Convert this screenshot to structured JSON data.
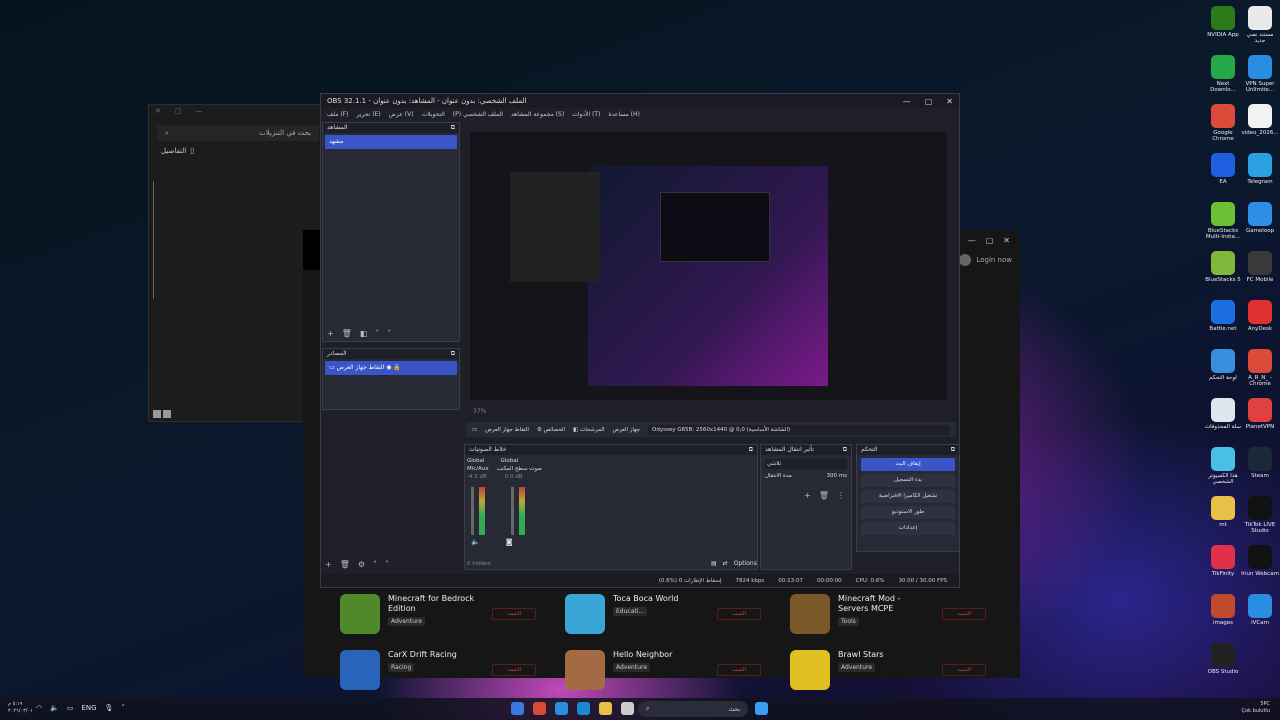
{
  "settings": {
    "search_placeholder": "بحث في التنزيلات",
    "details_label": "التفاصيل"
  },
  "store": {
    "login": "Login now",
    "buttons_label": "التثبيت",
    "apps": [
      {
        "name": "Minecraft for Bedrock Edition",
        "category": "Adventure",
        "color": "#4f8a2a"
      },
      {
        "name": "Toca Boca World",
        "category": "Educati...",
        "color": "#3aa6d8"
      },
      {
        "name": "Minecraft Mod - Servers MCPE",
        "category": "Tools",
        "color": "#7a5a2a"
      },
      {
        "name": "CarX Drift Racing",
        "category": "Racing",
        "color": "#2a64b8"
      },
      {
        "name": "Hello Neighbor",
        "category": "Adventure",
        "color": "#a46a44"
      },
      {
        "name": "Brawl Stars",
        "category": "Adventure",
        "color": "#e0c020"
      }
    ]
  },
  "obs": {
    "title": "OBS 32.1.1 - الملف الشخصي: بدون عنوان - المشاهد: بدون عنوان",
    "menu": [
      "ملف (F)",
      "تحرير (E)",
      "عرض (V)",
      "التحويلات",
      "(P) الملف الشخصي",
      "مجموعة المشاهد (S)",
      "الأدوات (T)",
      "مساعدة (H)"
    ],
    "scenes": {
      "header": "المشاهد",
      "items": [
        "مشهد"
      ]
    },
    "sources": {
      "header": "المصادر",
      "items": [
        "التقاط جهاز العرض"
      ]
    },
    "source_bar": {
      "properties": "الخصائص",
      "filters": "المرشحات",
      "display": "جهاز العرض",
      "value": "Odyssey G65B: 2560x1440 @ 0,0 (الشاشة الأساسية)",
      "display_capture": "التقاط جهاز العرض"
    },
    "audio": {
      "header": "خلاط الصوتيات",
      "ch1": "Mic/Aux",
      "ch2": "صوت سطح المكتب",
      "global": "Global",
      "db1": "-4.3 dB",
      "db2": "0.0 dB",
      "hidden": "0 hidden",
      "options": "Options"
    },
    "transition": {
      "header": "تأثير انتقال المشاهد",
      "type": "تلاشي",
      "duration_label": "مدة الانتقال",
      "duration": "300 ms"
    },
    "controls": {
      "header": "التحكم",
      "buttons": [
        "إيقاف البث",
        "بدء التسجيل",
        "تشغيل الكاميرا الافتراضية",
        "طور الاستوديو",
        "إعدادات"
      ]
    },
    "preview_zoom": "37%",
    "status": {
      "dropped": "(0.6%) 0 إسقاط الإطارات",
      "kbps": "7824 kbps",
      "live": "00:13:07",
      "rec": "00:00:00",
      "cpu": "CPU: 0.6%",
      "fps": "30.00 / 30.00 FPS"
    }
  },
  "desktop": {
    "icons": [
      {
        "label": "NVIDIA App",
        "color": "#2d7a1a"
      },
      {
        "label": "مستند نصي جديد",
        "color": "#eaeaea"
      },
      {
        "label": "Next Downlo...",
        "color": "#25a84a"
      },
      {
        "label": "VPN Super Unlimite...",
        "color": "#2a8ee0"
      },
      {
        "label": "Google Chrome",
        "color": "#d94a38"
      },
      {
        "label": "video_2026...",
        "color": "#f2f2f2"
      },
      {
        "label": "EA",
        "color": "#1e5fe0"
      },
      {
        "label": "Telegram",
        "color": "#2aa0e0"
      },
      {
        "label": "BlueStacks Multi-Insta...",
        "color": "#6ac036"
      },
      {
        "label": "Gameloop",
        "color": "#2e8ee8"
      },
      {
        "label": "BlueStacks 5",
        "color": "#7fb83a"
      },
      {
        "label": "FC Mobile",
        "color": "#3a3a3a"
      },
      {
        "label": "Battle.net",
        "color": "#1a6ee0"
      },
      {
        "label": "AnyDesk",
        "color": "#e03030"
      },
      {
        "label": "لوحة التحكم",
        "color": "#3a8ee0"
      },
      {
        "label": "A_R_N_ - Chrome",
        "color": "#d94a38"
      },
      {
        "label": "سلة المحذوفات",
        "color": "#dfe6ee"
      },
      {
        "label": "PlanetVPN",
        "color": "#e04040"
      },
      {
        "label": "هذا الكمبيوتر الشخصي",
        "color": "#4ac0e8"
      },
      {
        "label": "Steam",
        "color": "#1b2838"
      },
      {
        "label": "mt",
        "color": "#e8c048"
      },
      {
        "label": "TikTok LIVE Studio",
        "color": "#111"
      },
      {
        "label": "TikFinity",
        "color": "#e0304a"
      },
      {
        "label": "Iriun Webcam",
        "color": "#111"
      },
      {
        "label": "images",
        "color": "#c04a2a"
      },
      {
        "label": "iVCam",
        "color": "#2a8ee0"
      },
      {
        "label": "OBS Studio",
        "color": "#222"
      }
    ]
  },
  "taskbar": {
    "search": "بحث",
    "lang": "ENG",
    "time": "5PC",
    "date": "Çok bulutlu",
    "clock_l": "٥:١٩ م",
    "date_l": "٢٠٢٦/٠٣/٠١"
  }
}
